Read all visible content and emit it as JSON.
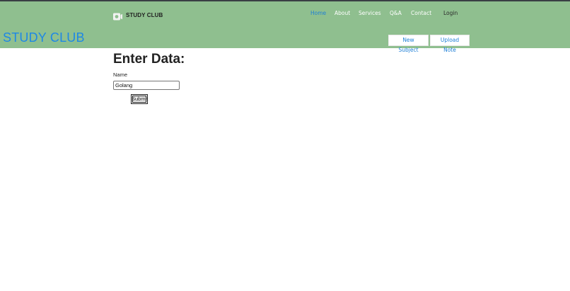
{
  "brand": {
    "name": "STUDY CLUB",
    "icon": "camera-icon"
  },
  "nav": {
    "items": [
      {
        "label": "Home",
        "active": true
      },
      {
        "label": "About",
        "active": false
      },
      {
        "label": "Services",
        "active": false
      },
      {
        "label": "Q&A",
        "active": false
      },
      {
        "label": "Contact",
        "active": false
      }
    ],
    "login_label": "Login"
  },
  "header": {
    "site_title": "STUDY CLUB",
    "new_subject_label": "New Subject",
    "upload_note_label": "Upload Note"
  },
  "form": {
    "title": "Enter Data:",
    "name_label": "Name",
    "name_value": "Golang",
    "submit_label": "Submit"
  },
  "colors": {
    "header_bg": "#8fbf8f",
    "accent": "#1e88e5",
    "top_bar": "#3a3f44"
  }
}
